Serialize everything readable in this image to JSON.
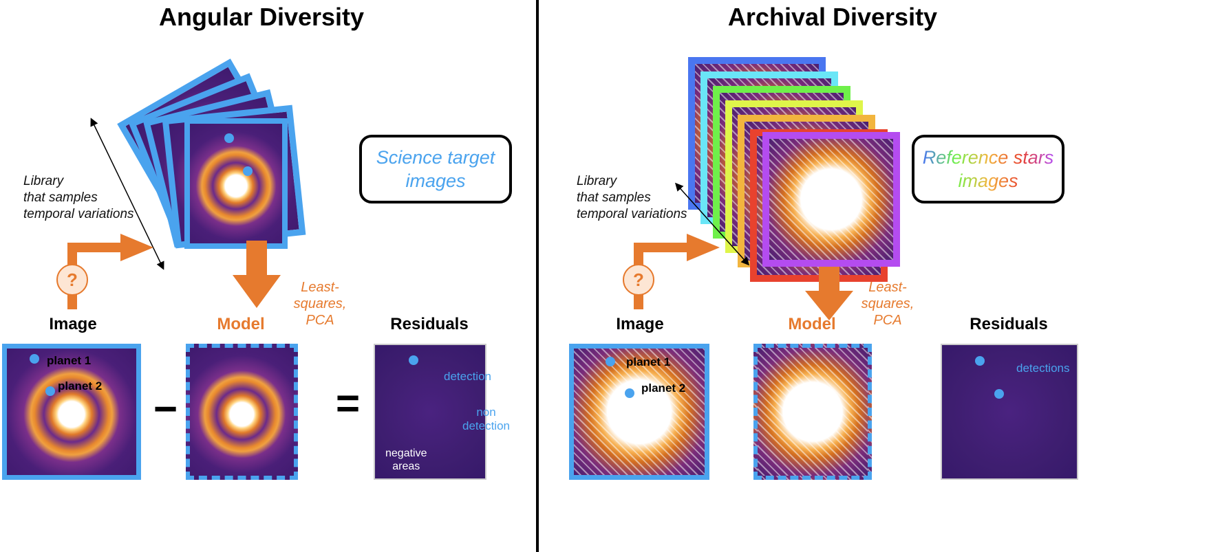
{
  "left": {
    "title": "Angular Diversity",
    "library_text": [
      "Library",
      "that samples",
      "temporal variations"
    ],
    "box_text": [
      "Science target",
      "images"
    ],
    "method_text": [
      "Least-squares,",
      "PCA"
    ],
    "labels": {
      "image": "Image",
      "model": "Model",
      "residuals": "Residuals"
    },
    "planet1": "planet 1",
    "planet2": "planet 2",
    "detection": "detection",
    "non_detection": [
      "non",
      "detection"
    ],
    "negative_areas": [
      "negative",
      "areas"
    ],
    "question": "?",
    "minus": "−",
    "equals": "="
  },
  "right": {
    "title": "Archival Diversity",
    "library_text": [
      "Library",
      "that samples",
      "temporal variations"
    ],
    "box_text": [
      "Reference stars",
      "images"
    ],
    "method_text": [
      "Least-squares,",
      "PCA"
    ],
    "labels": {
      "image": "Image",
      "model": "Model",
      "residuals": "Residuals"
    },
    "planet1": "planet 1",
    "planet2": "planet 2",
    "detections": "detections",
    "question": "?",
    "minus": "−",
    "equals": "="
  },
  "colors": {
    "accent_orange": "#e67a2e",
    "frame_blue": "#4aa3ee",
    "stack_frames": [
      "#4a76f0",
      "#6ae6f7",
      "#6ff04a",
      "#dff54a",
      "#f2b53e",
      "#e8422e",
      "#b44cf0"
    ]
  }
}
